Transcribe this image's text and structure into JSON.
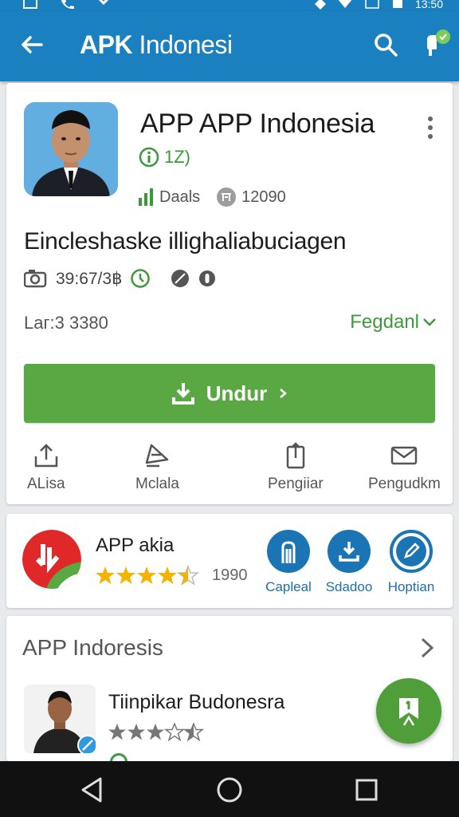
{
  "status_bar": {
    "time": "13:50"
  },
  "app_bar": {
    "title_bold": "APK",
    "title_rest": " Indonesi"
  },
  "app": {
    "name": "APP APP Indonesia",
    "rating_text": "1Z)",
    "meta": [
      {
        "label": "Daals",
        "icon": "bar-chart-icon"
      },
      {
        "label": "12090",
        "icon": "badge-icon"
      }
    ],
    "description": "Eincleshaske illighaliabuciagen",
    "info": "39:67/3฿",
    "size_label": "Laг:3 3380",
    "more_link": "Fegdanl",
    "install_label": "Undur",
    "actions": [
      {
        "label": "ALisa",
        "icon": "share-icon"
      },
      {
        "label": "Mclala",
        "icon": "send-icon"
      },
      {
        "label": "Pengiiar",
        "icon": "upload-icon"
      },
      {
        "label": "Pengudkm",
        "icon": "mail-icon"
      }
    ]
  },
  "related": {
    "name": "APP akia",
    "stars": 4.5,
    "count": "1990",
    "chips": [
      {
        "label": "Capleal",
        "icon": "pin-icon"
      },
      {
        "label": "Sdadoo",
        "icon": "download-icon"
      },
      {
        "label": "Hoptian",
        "icon": "edit-icon"
      }
    ]
  },
  "section": {
    "title": "APP Indoresis",
    "item_name": "Tiinpikar Budonesra",
    "item_stars": 3.5
  },
  "colors": {
    "primary": "#1b80c0",
    "accent": "#5aa843",
    "link": "#3d9a3d"
  }
}
